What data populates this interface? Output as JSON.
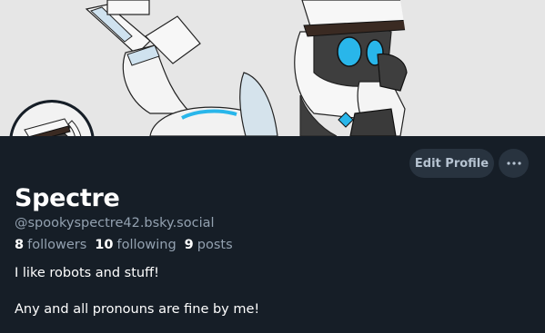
{
  "profile": {
    "display_name": "Spectre",
    "handle": "@spookyspectre42.bsky.social",
    "stats": {
      "followers_count": "8",
      "followers_label": "followers",
      "following_count": "10",
      "following_label": "following",
      "posts_count": "9",
      "posts_label": "posts"
    },
    "bio": {
      "line1": "I like robots and stuff!",
      "line2": "Any and all pronouns are fine by me!"
    }
  },
  "actions": {
    "edit_profile_label": "Edit Profile",
    "more_icon": "more-horizontal-icon"
  },
  "colors": {
    "background": "#161e27",
    "button_bg": "#28333f",
    "muted_text": "#93a1b0",
    "accent_cyan": "#29b6ea"
  }
}
